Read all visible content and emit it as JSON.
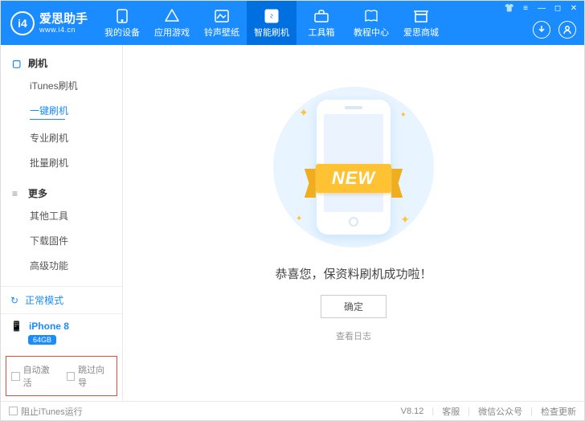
{
  "brand": {
    "name": "爱思助手",
    "url": "www.i4.cn",
    "logo_text": "i4"
  },
  "tabs": [
    {
      "label": "我的设备"
    },
    {
      "label": "应用游戏"
    },
    {
      "label": "铃声壁纸"
    },
    {
      "label": "智能刷机",
      "active": true
    },
    {
      "label": "工具箱"
    },
    {
      "label": "教程中心"
    },
    {
      "label": "爱思商城"
    }
  ],
  "sidebar": {
    "groups": [
      {
        "title": "刷机",
        "items": [
          {
            "label": "iTunes刷机"
          },
          {
            "label": "一键刷机",
            "active": true
          },
          {
            "label": "专业刷机"
          },
          {
            "label": "批量刷机"
          }
        ]
      },
      {
        "title": "更多",
        "items": [
          {
            "label": "其他工具"
          },
          {
            "label": "下载固件"
          },
          {
            "label": "高级功能"
          }
        ]
      }
    ],
    "mode_label": "正常模式",
    "device": {
      "name": "iPhone 8",
      "capacity": "64GB"
    },
    "check1_label": "自动激活",
    "check2_label": "跳过向导"
  },
  "main": {
    "ribbon_text": "NEW",
    "success_text": "恭喜您，保资料刷机成功啦！",
    "ok_label": "确定",
    "log_label": "查看日志"
  },
  "footer": {
    "block_itunes_label": "阻止iTunes运行",
    "version": "V8.12",
    "kefu": "客服",
    "wechat": "微信公众号",
    "update": "检查更新"
  }
}
